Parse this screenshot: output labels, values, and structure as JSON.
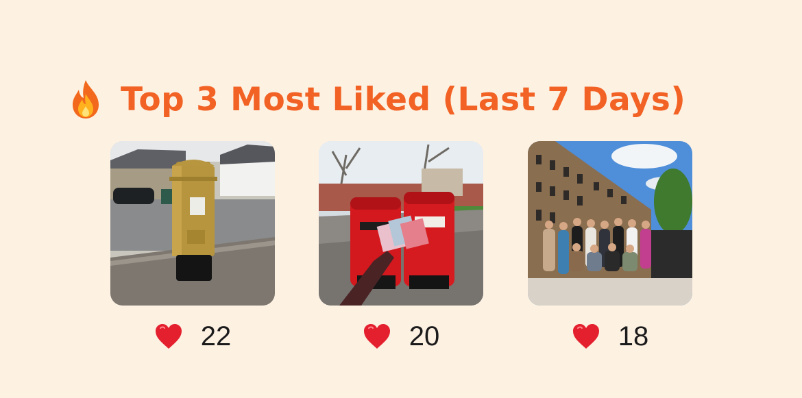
{
  "header": {
    "icon": "fire-icon",
    "title": "Top 3 Most Liked (Last 7 Days)",
    "title_color": "#F26224"
  },
  "background_color": "#FDF1E2",
  "cards": [
    {
      "photo": "gold-postbox-photo",
      "like_icon": "heart-icon",
      "likes": "22"
    },
    {
      "photo": "red-postboxes-photo",
      "like_icon": "heart-icon",
      "likes": "20"
    },
    {
      "photo": "group-photo",
      "like_icon": "heart-icon",
      "likes": "18"
    }
  ]
}
